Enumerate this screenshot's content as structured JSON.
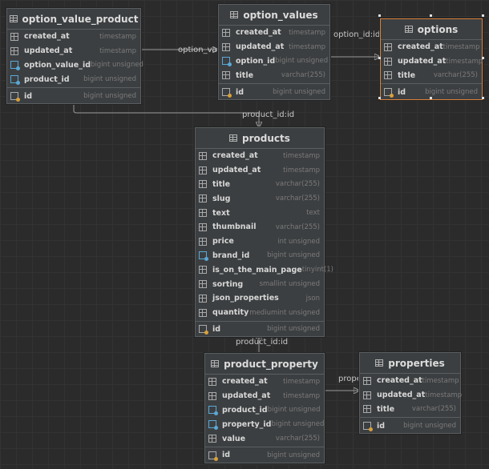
{
  "tables": {
    "option_value_product": {
      "name": "option_value_product",
      "columns": [
        {
          "name": "created_at",
          "type": "timestamp",
          "kind": "column"
        },
        {
          "name": "updated_at",
          "type": "timestamp",
          "kind": "column"
        },
        {
          "name": "option_value_id",
          "type": "bigint unsigned",
          "kind": "foreign-key"
        },
        {
          "name": "product_id",
          "type": "bigint unsigned",
          "kind": "foreign-key"
        }
      ],
      "key": {
        "name": "id",
        "type": "bigint unsigned",
        "kind": "primary-key"
      }
    },
    "option_values": {
      "name": "option_values",
      "columns": [
        {
          "name": "created_at",
          "type": "timestamp",
          "kind": "column"
        },
        {
          "name": "updated_at",
          "type": "timestamp",
          "kind": "column"
        },
        {
          "name": "option_id",
          "type": "bigint unsigned",
          "kind": "foreign-key"
        },
        {
          "name": "title",
          "type": "varchar(255)",
          "kind": "column"
        }
      ],
      "key": {
        "name": "id",
        "type": "bigint unsigned",
        "kind": "primary-key"
      }
    },
    "options": {
      "name": "options",
      "selected": true,
      "columns": [
        {
          "name": "created_at",
          "type": "timestamp",
          "kind": "column"
        },
        {
          "name": "updated_at",
          "type": "timestamp",
          "kind": "column"
        },
        {
          "name": "title",
          "type": "varchar(255)",
          "kind": "column"
        }
      ],
      "key": {
        "name": "id",
        "type": "bigint unsigned",
        "kind": "primary-key"
      }
    },
    "products": {
      "name": "products",
      "columns": [
        {
          "name": "created_at",
          "type": "timestamp",
          "kind": "column"
        },
        {
          "name": "updated_at",
          "type": "timestamp",
          "kind": "column"
        },
        {
          "name": "title",
          "type": "varchar(255)",
          "kind": "column"
        },
        {
          "name": "slug",
          "type": "varchar(255)",
          "kind": "column"
        },
        {
          "name": "text",
          "type": "text",
          "kind": "column"
        },
        {
          "name": "thumbnail",
          "type": "varchar(255)",
          "kind": "column"
        },
        {
          "name": "price",
          "type": "int unsigned",
          "kind": "column"
        },
        {
          "name": "brand_id",
          "type": "bigint unsigned",
          "kind": "foreign-key"
        },
        {
          "name": "is_on_the_main_page",
          "type": "tinyint(1)",
          "kind": "column"
        },
        {
          "name": "sorting",
          "type": "smallint unsigned",
          "kind": "column"
        },
        {
          "name": "json_properties",
          "type": "json",
          "kind": "column"
        },
        {
          "name": "quantity",
          "type": "mediumint unsigned",
          "kind": "column"
        }
      ],
      "key": {
        "name": "id",
        "type": "bigint unsigned",
        "kind": "primary-key"
      }
    },
    "product_property": {
      "name": "product_property",
      "columns": [
        {
          "name": "created_at",
          "type": "timestamp",
          "kind": "column"
        },
        {
          "name": "updated_at",
          "type": "timestamp",
          "kind": "column"
        },
        {
          "name": "product_id",
          "type": "bigint unsigned",
          "kind": "foreign-key"
        },
        {
          "name": "property_id",
          "type": "bigint unsigned",
          "kind": "foreign-key"
        },
        {
          "name": "value",
          "type": "varchar(255)",
          "kind": "column"
        }
      ],
      "key": {
        "name": "id",
        "type": "bigint unsigned",
        "kind": "primary-key"
      }
    },
    "properties": {
      "name": "properties",
      "columns": [
        {
          "name": "created_at",
          "type": "timestamp",
          "kind": "column"
        },
        {
          "name": "updated_at",
          "type": "timestamp",
          "kind": "column"
        },
        {
          "name": "title",
          "type": "varchar(255)",
          "kind": "column"
        }
      ],
      "key": {
        "name": "id",
        "type": "bigint unsigned",
        "kind": "primary-key"
      }
    }
  },
  "relations": {
    "ovp_option_values": "option_value_id:id",
    "ovp_products": "product_id:id",
    "option_values_options": "option_id:id",
    "pp_products": "product_id:id",
    "pp_properties": "property_id:id"
  },
  "colors": {
    "background": "#2b2b2b",
    "panel": "#3c3f41",
    "selected_border": "#d9803a",
    "foreign_key": "#5aa8d6",
    "primary_key": "#d9a13a"
  }
}
